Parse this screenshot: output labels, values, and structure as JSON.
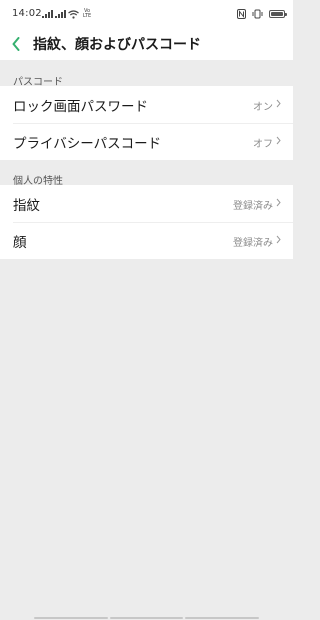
{
  "status_bar": {
    "time": "14:02",
    "network_badge": "Vo LTE",
    "icons": [
      "signal-icon",
      "signal-icon",
      "wifi-icon",
      "nfc-icon",
      "vibrate-icon",
      "battery-icon"
    ]
  },
  "header": {
    "title": "指紋、顔およびパスコード"
  },
  "accent_color": "#35b06f",
  "sections": [
    {
      "title": "パスコード",
      "items": [
        {
          "label": "ロック画面パスワード",
          "value": "オン"
        },
        {
          "label": "プライバシーパスコード",
          "value": "オフ"
        }
      ]
    },
    {
      "title": "個人の特性",
      "items": [
        {
          "label": "指紋",
          "value": "登録済み"
        },
        {
          "label": "顔",
          "value": "登録済み"
        }
      ]
    }
  ]
}
